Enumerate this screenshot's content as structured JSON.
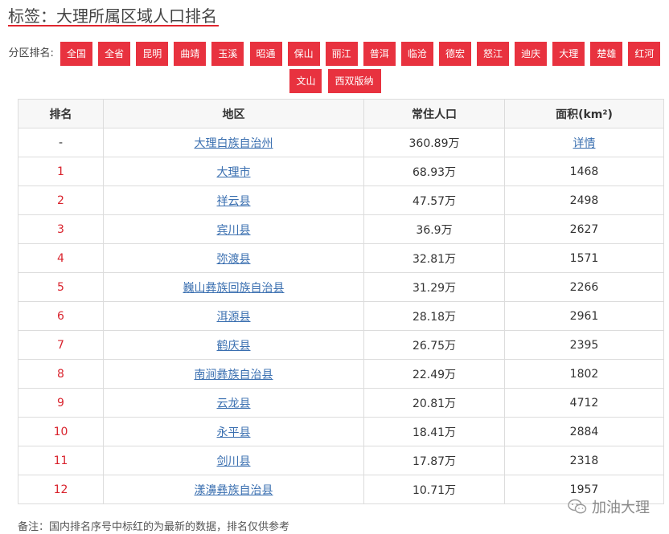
{
  "header": {
    "title": "标签：大理所属区域人口排名"
  },
  "filter": {
    "label": "分区排名:",
    "tags": [
      "全国",
      "全省",
      "昆明",
      "曲靖",
      "玉溪",
      "昭通",
      "保山",
      "丽江",
      "普洱",
      "临沧",
      "德宏",
      "怒江",
      "迪庆",
      "大理",
      "楚雄",
      "红河",
      "文山",
      "西双版纳"
    ]
  },
  "table": {
    "headers": [
      "排名",
      "地区",
      "常住人口",
      "面积(km²)"
    ],
    "rows": [
      {
        "rank": "-",
        "region": "大理白族自治州",
        "population": "360.89万",
        "area": "详情"
      },
      {
        "rank": "1",
        "region": "大理市",
        "population": "68.93万",
        "area": "1468"
      },
      {
        "rank": "2",
        "region": "祥云县",
        "population": "47.57万",
        "area": "2498"
      },
      {
        "rank": "3",
        "region": "宾川县",
        "population": "36.9万",
        "area": "2627"
      },
      {
        "rank": "4",
        "region": "弥渡县",
        "population": "32.81万",
        "area": "1571"
      },
      {
        "rank": "5",
        "region": "巍山彝族回族自治县",
        "population": "31.29万",
        "area": "2266"
      },
      {
        "rank": "6",
        "region": "洱源县",
        "population": "28.18万",
        "area": "2961"
      },
      {
        "rank": "7",
        "region": "鹤庆县",
        "population": "26.75万",
        "area": "2395"
      },
      {
        "rank": "8",
        "region": "南涧彝族自治县",
        "population": "22.49万",
        "area": "1802"
      },
      {
        "rank": "9",
        "region": "云龙县",
        "population": "20.81万",
        "area": "4712"
      },
      {
        "rank": "10",
        "region": "永平县",
        "population": "18.41万",
        "area": "2884"
      },
      {
        "rank": "11",
        "region": "剑川县",
        "population": "17.87万",
        "area": "2318"
      },
      {
        "rank": "12",
        "region": "漾濞彝族自治县",
        "population": "10.71万",
        "area": "1957"
      }
    ]
  },
  "footer": {
    "note": "备注：国内排名序号中标红的为最新的数据，排名仅供参考",
    "watermark": "加油大理",
    "watermark_icon": "wechat-icon"
  },
  "colors": {
    "accent": "#e8323f",
    "rank_red": "#d9232d",
    "link": "#3a6fb0"
  }
}
